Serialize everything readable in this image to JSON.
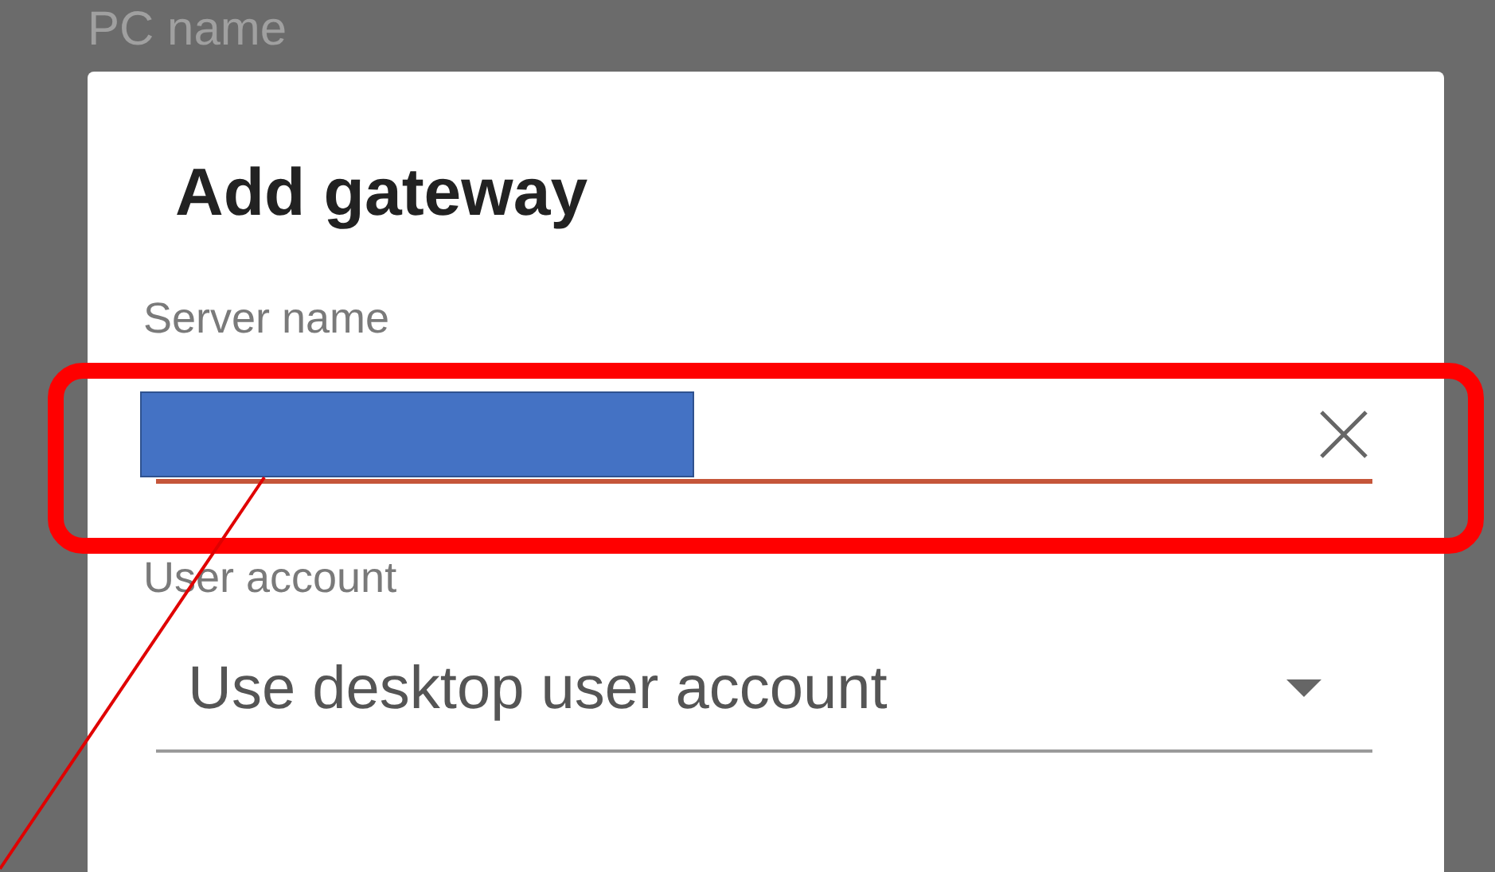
{
  "background": {
    "label": "PC name"
  },
  "dialog": {
    "title": "Add gateway",
    "fields": [
      {
        "kind": "text",
        "label": "Server name",
        "redacted": true,
        "focused": true
      },
      {
        "kind": "select",
        "label": "User account",
        "value": "Use desktop user account"
      }
    ]
  }
}
